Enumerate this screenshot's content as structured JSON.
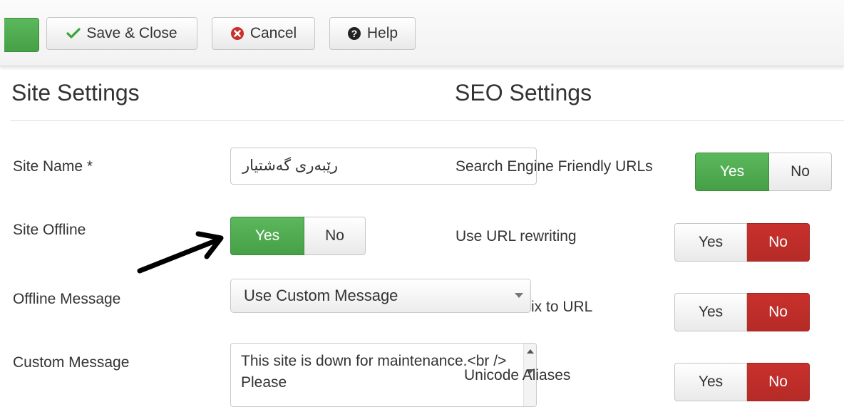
{
  "toolbar": {
    "save_close_label": "Save & Close",
    "cancel_label": "Cancel",
    "help_label": "Help"
  },
  "site_settings": {
    "heading": "Site Settings",
    "site_name": {
      "label": "Site Name *",
      "value": "رێبەری گەشتیار"
    },
    "site_offline": {
      "label": "Site Offline",
      "yes": "Yes",
      "no": "No",
      "selected": "Yes"
    },
    "offline_message": {
      "label": "Offline Message",
      "selected": "Use Custom Message"
    },
    "custom_message": {
      "label": "Custom Message",
      "value": "This site is down for maintenance.<br /> Please"
    }
  },
  "seo_settings": {
    "heading": "SEO Settings",
    "sef_urls": {
      "label": "Search Engine Friendly URLs",
      "yes": "Yes",
      "no": "No",
      "selected": "Yes"
    },
    "url_rewriting": {
      "label": "Use URL rewriting",
      "yes": "Yes",
      "no": "No",
      "selected": "No"
    },
    "suffix": {
      "label": "ix to URL",
      "yes": "Yes",
      "no": "No",
      "selected": "No"
    },
    "unicode_aliases": {
      "label": "Unicode Aliases",
      "yes": "Yes",
      "no": "No",
      "selected": "No"
    }
  },
  "colors": {
    "green": "#46a046",
    "red": "#b52b27"
  },
  "icons": [
    "check-icon",
    "cancel-circle-icon",
    "help-circle-icon",
    "arrow-icon"
  ]
}
